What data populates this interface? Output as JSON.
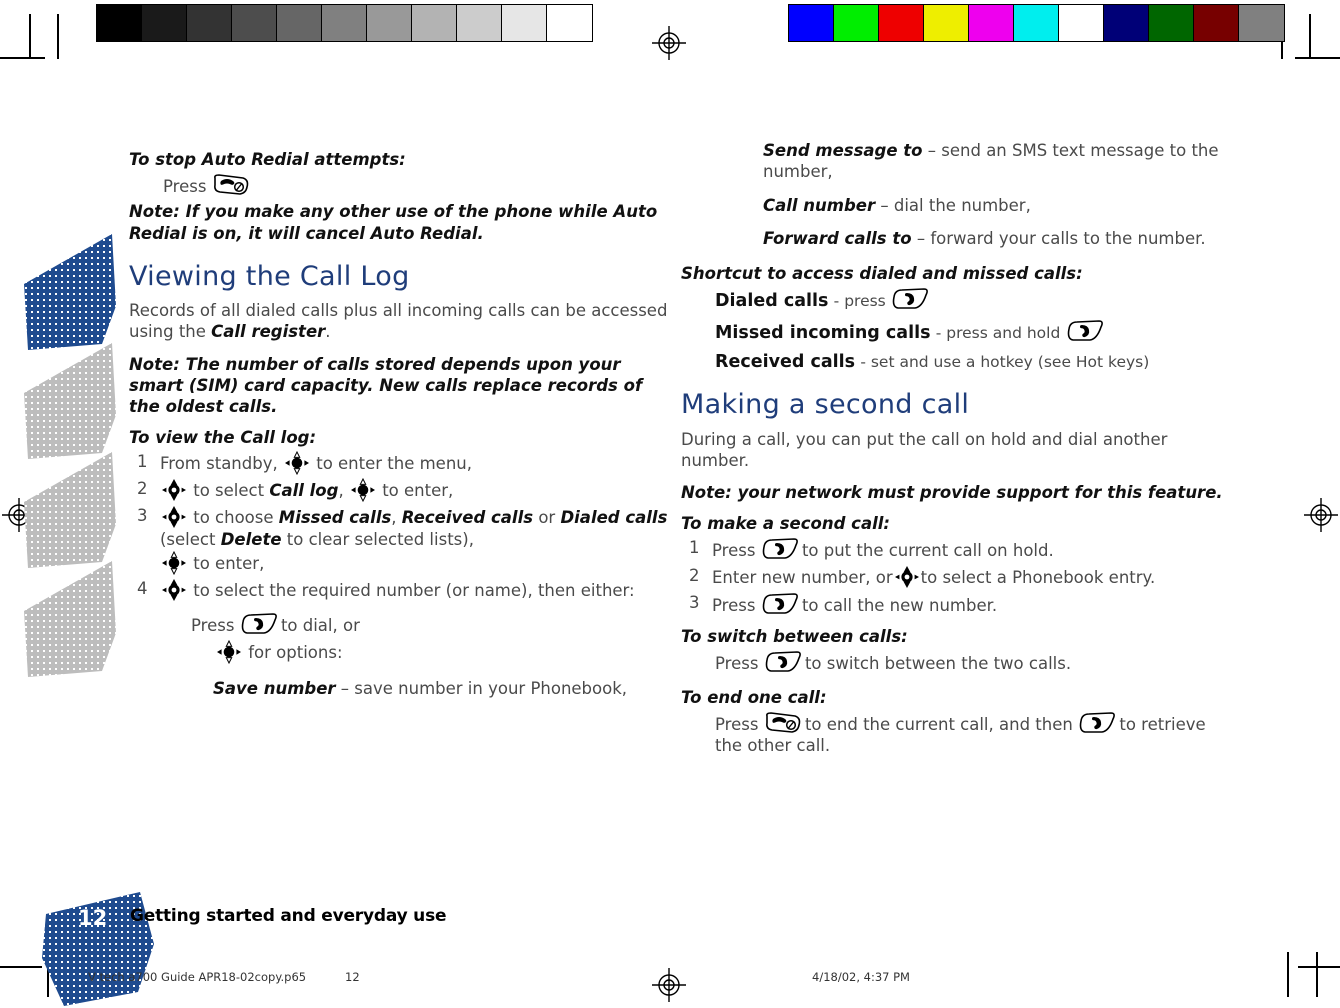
{
  "document": {
    "title": "Viewing the Call Log",
    "footer_title": "Getting started and everyday use",
    "page_number": "12"
  },
  "print_meta": {
    "file_name": "V tech a700 Guide APR18-02copy.p65",
    "page_label": "12",
    "date_time": "4/18/02, 4:37 PM"
  },
  "calibration": {
    "gray_bar": [
      "#000000",
      "#1a1a1a",
      "#333333",
      "#4d4d4d",
      "#666666",
      "#808080",
      "#999999",
      "#b3b3b3",
      "#cccccc",
      "#e6e6e6",
      "#ffffff"
    ],
    "color_bar": [
      "#0000ff",
      "#00ee00",
      "#ee0000",
      "#eeee00",
      "#ee00ee",
      "#00eeee",
      "#ffffff",
      "#000077",
      "#006600",
      "#770000",
      "#808080"
    ]
  },
  "colors": {
    "heading_blue": "#1f3d7a",
    "tab_blue": "#1f4b8f",
    "tab_gray": "#b9b9b9",
    "body_gray": "#4a4a4a"
  },
  "left_column": {
    "s1_lead": "To stop Auto Redial attempts:",
    "s1_press": "Press",
    "s1_note": "Note: If you make any other use of the phone while Auto Redial is on, it will cancel Auto Redial.",
    "heading": "Viewing the Call Log",
    "intro_a": "Records of all dialed calls plus all incoming calls can be accessed using the ",
    "intro_term": "Call register",
    "intro_b": ".",
    "note2": "Note: The number of calls stored depends upon your smart (SIM) card capacity. New calls replace records of the oldest calls.",
    "steps_lead": "To view the Call log:",
    "step1_num": "1",
    "step1_a": "From standby,",
    "step1_b": "to enter the menu,",
    "step2_num": "2",
    "step2_a": "to select",
    "step2_term": "Call log",
    "step2_b": ",",
    "step2_c": "to enter,",
    "step3_num": "3",
    "step3_a": "to choose",
    "step3_t1": "Missed calls",
    "step3_sep1": ",",
    "step3_t2": "Received calls",
    "step3_or": "or",
    "step3_t3": "Dialed calls",
    "step3_b": "(select",
    "step3_t4": "Delete",
    "step3_c": "to clear selected lists),",
    "step3_d": "to enter,",
    "step4_num": "4",
    "step4_a": "to select the required number (or name), then either:",
    "press_dial_a": "Press",
    "press_dial_b": "to dial, or",
    "options_label": "for options:",
    "save_term": "Save number",
    "save_dash": "–",
    "save_desc": "save number in your Phonebook,"
  },
  "right_column": {
    "opt1_term": "Send message to",
    "opt1_dash": "–",
    "opt1_desc": "send an SMS text message to the number,",
    "opt2_term": "Call number",
    "opt2_dash": "–",
    "opt2_desc": "dial the number,",
    "opt3_term": "Forward calls to",
    "opt3_dash": "–",
    "opt3_desc": "forward your calls to the number.",
    "shortcut_lead": "Shortcut to access dialed and missed calls:",
    "sc1_label": "Dialed calls",
    "sc1_desc": "- press",
    "sc2_label": "Missed incoming calls",
    "sc2_desc": "- press and hold",
    "sc3_label": "Received calls",
    "sc3_desc": "- set and use a hotkey (see Hot keys)",
    "heading2": "Making a second call",
    "intro2": "During a call, you can put the call on hold and dial another number.",
    "note3": "Note: your network must provide support for this feature.",
    "make_lead": "To make a second call:",
    "m1_num": "1",
    "m1_a": "Press",
    "m1_b": "to put the current call on hold.",
    "m2_num": "2",
    "m2_a": "Enter new number, or",
    "m2_b": "to select a Phonebook entry.",
    "m3_num": "3",
    "m3_a": "Press",
    "m3_b": "to call the new number.",
    "switch_lead": "To switch between calls:",
    "switch_a": "Press",
    "switch_b": "to switch between the two calls.",
    "end_lead": "To end one call:",
    "end_a": "Press",
    "end_b": "to end the current call, and then",
    "end_c": "to retrieve the other call."
  },
  "icons": {
    "call_key": "call-key-icon",
    "end_key": "end-call-key-icon",
    "nav_key": "navigation-key-icon",
    "nav_enter_key": "navigation-enter-key-icon",
    "registration_mark": "registration-mark-icon",
    "crop_mark": "crop-mark-icon"
  }
}
